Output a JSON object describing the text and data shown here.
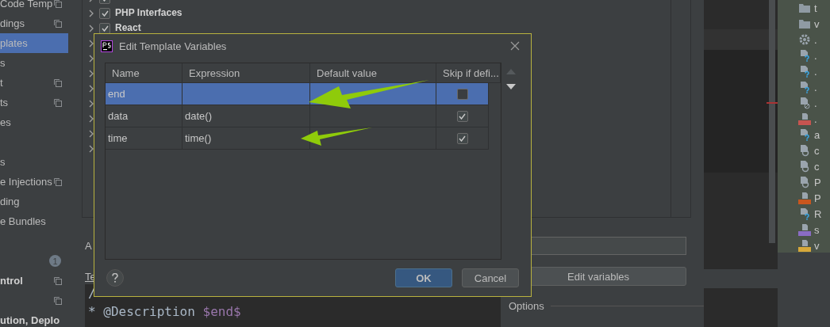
{
  "sidebar": {
    "items": [
      {
        "kind": "item",
        "label": "Code Temp",
        "selected": false,
        "bold": false,
        "shared": true
      },
      {
        "kind": "item",
        "label": "dings",
        "selected": false,
        "bold": false,
        "shared": true
      },
      {
        "kind": "item",
        "label": "plates",
        "selected": true,
        "bold": false,
        "shared": false
      },
      {
        "kind": "item",
        "label": "s",
        "selected": false,
        "bold": false,
        "shared": false
      },
      {
        "kind": "item",
        "label": "t",
        "selected": false,
        "bold": false,
        "shared": true
      },
      {
        "kind": "item",
        "label": "ts",
        "selected": false,
        "bold": false,
        "shared": true
      },
      {
        "kind": "item",
        "label": "es",
        "selected": false,
        "bold": false,
        "shared": false
      },
      {
        "kind": "spacer"
      },
      {
        "kind": "item",
        "label": "s",
        "selected": false,
        "bold": false,
        "shared": false
      },
      {
        "kind": "item",
        "label": "e Injections",
        "selected": false,
        "bold": false,
        "shared": true
      },
      {
        "kind": "item",
        "label": "ding",
        "selected": false,
        "bold": false,
        "shared": false
      },
      {
        "kind": "item",
        "label": "e Bundles",
        "selected": false,
        "bold": false,
        "shared": false
      },
      {
        "kind": "spacer"
      },
      {
        "kind": "badge",
        "label": "1"
      },
      {
        "kind": "item",
        "label": "ntrol",
        "selected": false,
        "bold": true,
        "shared": true
      },
      {
        "kind": "icon",
        "shared": true
      },
      {
        "kind": "item",
        "label": "ution, Deplo",
        "selected": false,
        "bold": true,
        "shared": false
      }
    ]
  },
  "template_tree": {
    "rows": [
      {
        "kind": "partial",
        "checked": true
      },
      {
        "kind": "labeled",
        "label": "PHP Interfaces",
        "checked": true
      },
      {
        "kind": "labeled",
        "label": "React",
        "checked": true
      },
      {
        "kind": "chevron"
      },
      {
        "kind": "chevron"
      },
      {
        "kind": "chevron"
      },
      {
        "kind": "chevron"
      },
      {
        "kind": "chevron"
      },
      {
        "kind": "chevron"
      },
      {
        "kind": "chevron"
      },
      {
        "kind": "chevron"
      }
    ]
  },
  "abbreviation_label": "A",
  "template_text_label": "Te",
  "edit_variables_button": "Edit variables",
  "code": {
    "line_1": "/",
    "line_2": "* @Description ",
    "variable": "$end$"
  },
  "options_label": "Options",
  "project_tree": {
    "items": [
      {
        "kind": "folder",
        "label": "t"
      },
      {
        "kind": "folder",
        "label": "v"
      },
      {
        "kind": "gear",
        "label": "."
      },
      {
        "kind": "unknown",
        "label": "."
      },
      {
        "kind": "unknown",
        "label": "."
      },
      {
        "kind": "unknown",
        "label": "."
      },
      {
        "kind": "ignored",
        "label": "."
      },
      {
        "kind": "yml",
        "label": "."
      },
      {
        "kind": "unknown",
        "label": "a"
      },
      {
        "kind": "config",
        "label": "c"
      },
      {
        "kind": "config",
        "label": "c"
      },
      {
        "kind": "config",
        "label": "P"
      },
      {
        "kind": "html",
        "label": "P"
      },
      {
        "kind": "unknown",
        "label": "R"
      },
      {
        "kind": "php",
        "label": "s"
      },
      {
        "kind": "js",
        "label": "v"
      }
    ]
  },
  "dialog": {
    "title": "Edit Template Variables",
    "columns": [
      "Name",
      "Expression",
      "Default value",
      "Skip if defi..."
    ],
    "rows": [
      {
        "name": "end",
        "expression": "",
        "selected": true,
        "skip": false
      },
      {
        "name": "data",
        "expression": "date()",
        "selected": false,
        "skip": true
      },
      {
        "name": "time",
        "expression": "time()",
        "selected": false,
        "skip": true
      }
    ],
    "buttons": [
      {
        "label": "OK",
        "default": true
      },
      {
        "label": "Cancel",
        "default": false
      }
    ]
  }
}
